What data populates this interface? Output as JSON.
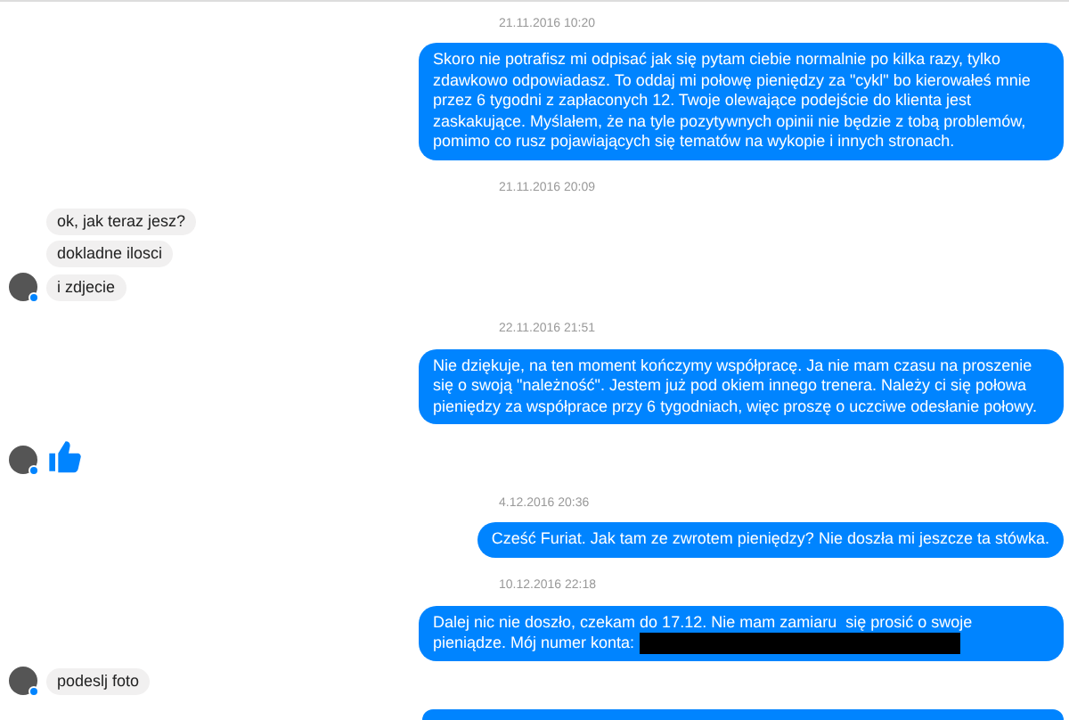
{
  "messages": [
    {
      "kind": "timestamp",
      "text": "21.11.2016 10:20"
    },
    {
      "kind": "sent",
      "text": "Skoro nie potrafisz mi odpisać jak się pytam ciebie normalnie po kilka razy, tylko zdawkowo odpowiadasz. To oddaj mi połowę pieniędzy za \"cykl\" bo kierowałeś mnie przez 6 tygodni z zapłaconych 12. Twoje olewające podejście do klienta jest zaskakujące. Myślałem, że na tyle pozytywnych opinii nie będzie z tobą problemów, pomimo co rusz pojawiających się tematów na wykopie i innych stronach.",
      "redacted": false
    },
    {
      "kind": "timestamp",
      "text": "21.11.2016 20:09"
    },
    {
      "kind": "received",
      "text": "ok, jak teraz jesz?",
      "avatar": false
    },
    {
      "kind": "received",
      "text": "dokladne ilosci",
      "avatar": false
    },
    {
      "kind": "received",
      "text": "i zdjecie",
      "avatar": true
    },
    {
      "kind": "timestamp",
      "text": "22.11.2016 21:51"
    },
    {
      "kind": "sent",
      "text": "Nie dziękuje, na ten moment kończymy współpracę. Ja nie mam czasu na proszenie się o swoją \"należność\". Jestem już pod okiem innego trenera. Należy ci się połowa pieniędzy za współprace przy 6 tygodniach, więc proszę o uczciwe odesłanie połowy.",
      "redacted": false
    },
    {
      "kind": "like",
      "avatar": true
    },
    {
      "kind": "timestamp",
      "text": "4.12.2016 20:36"
    },
    {
      "kind": "sent",
      "text": "Cześć Furiat. Jak tam ze zwrotem pieniędzy? Nie doszła mi jeszcze ta stówka.",
      "redacted": false
    },
    {
      "kind": "timestamp",
      "text": "10.12.2016 22:18"
    },
    {
      "kind": "sent",
      "text": "Dalej nic nie doszło, czekam do 17.12. Nie mam zamiaru  się prosić o swoje pieniądze. Mój numer konta:",
      "redacted": true
    },
    {
      "kind": "received",
      "text": "podeslj foto",
      "avatar": true
    },
    {
      "kind": "cut_bubble"
    }
  ]
}
